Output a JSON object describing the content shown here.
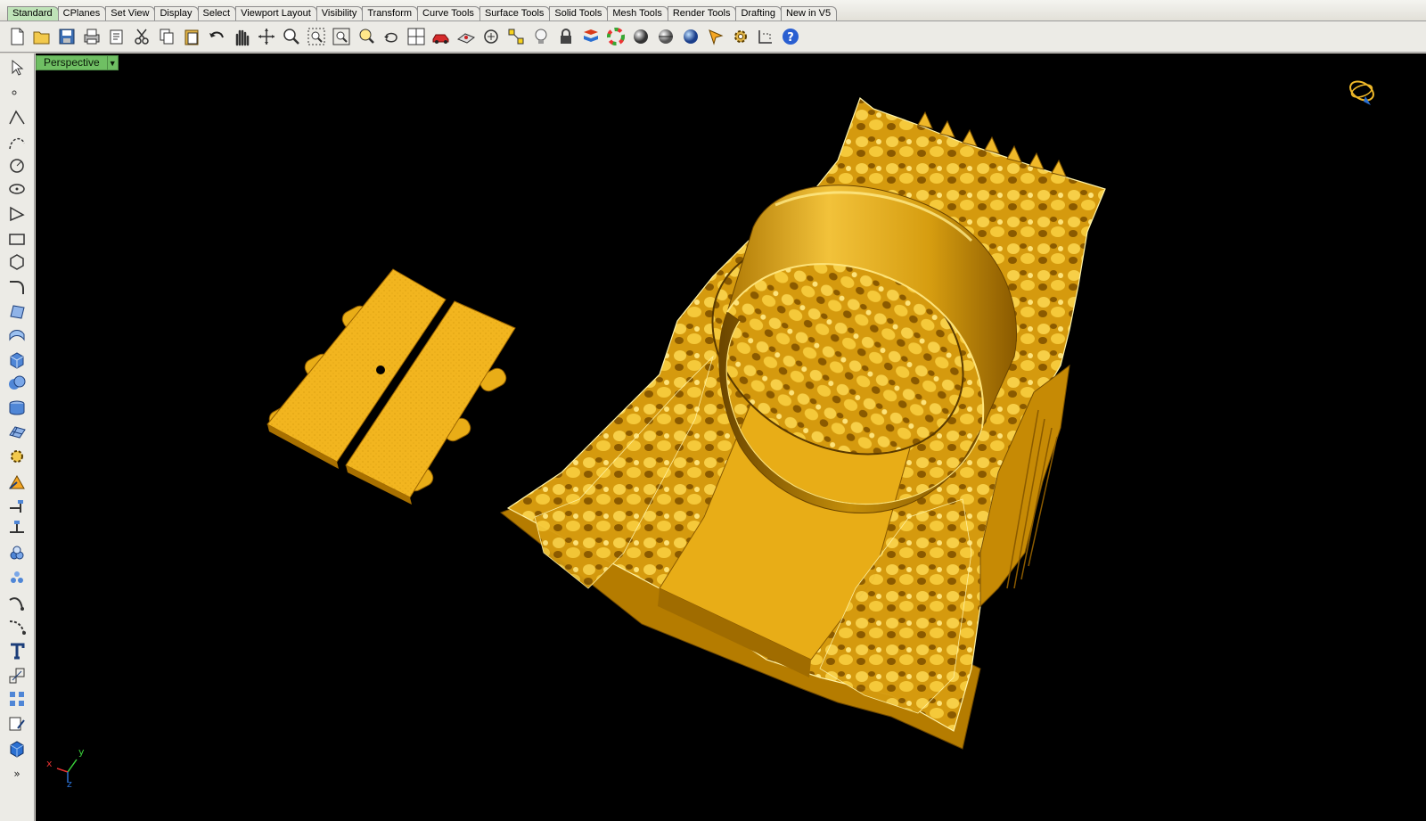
{
  "tabs": [
    {
      "label": "Standard",
      "active": true
    },
    {
      "label": "CPlanes"
    },
    {
      "label": "Set View"
    },
    {
      "label": "Display"
    },
    {
      "label": "Select"
    },
    {
      "label": "Viewport Layout"
    },
    {
      "label": "Visibility"
    },
    {
      "label": "Transform"
    },
    {
      "label": "Curve Tools"
    },
    {
      "label": "Surface Tools"
    },
    {
      "label": "Solid Tools"
    },
    {
      "label": "Mesh Tools"
    },
    {
      "label": "Render Tools"
    },
    {
      "label": "Drafting"
    },
    {
      "label": "New in V5"
    }
  ],
  "viewport": {
    "title": "Perspective",
    "axes": {
      "x": "x",
      "y": "y",
      "z": "z"
    }
  },
  "colors": {
    "accent_tab": "#bfe3b8",
    "viewport_title": "#6fbf63",
    "model_gold": "#e8b21a",
    "background": "#000000"
  }
}
